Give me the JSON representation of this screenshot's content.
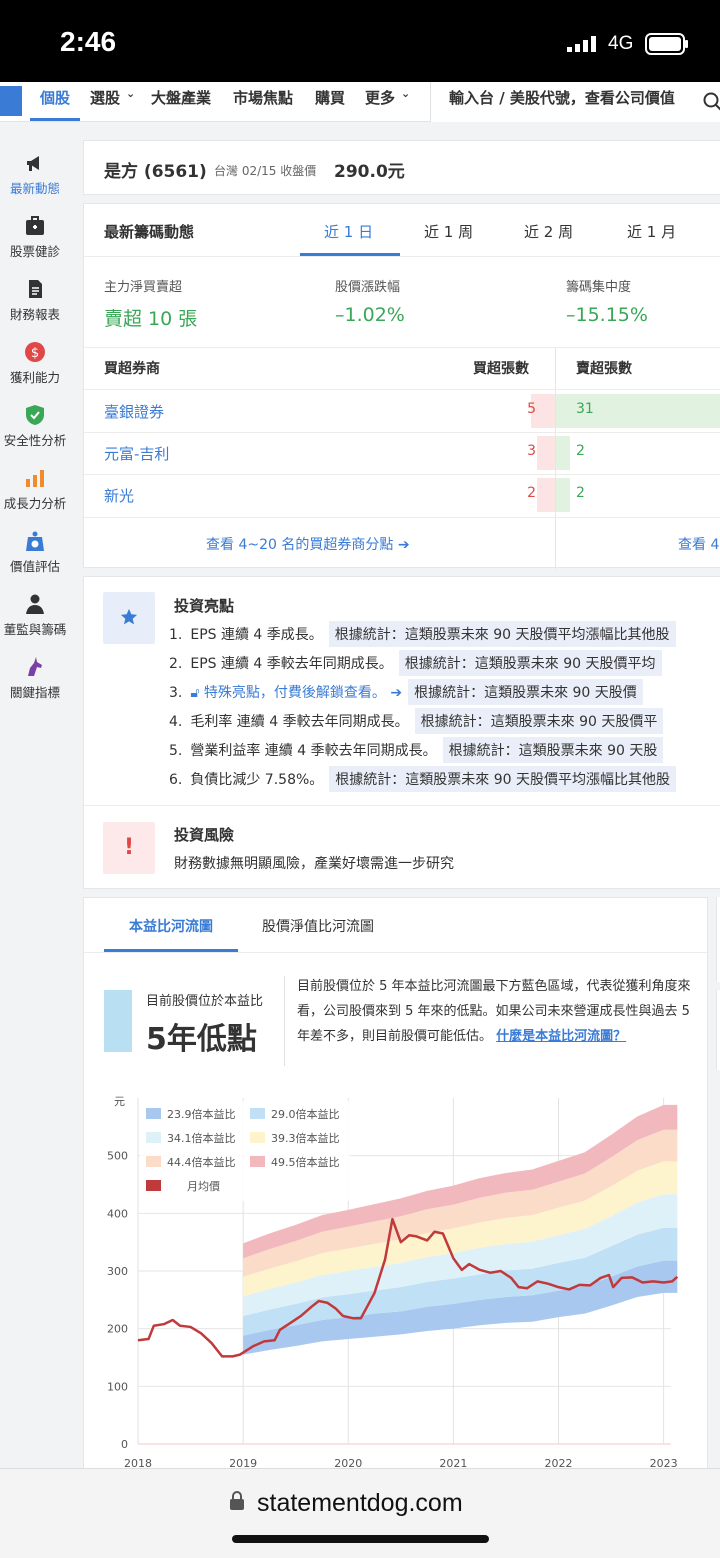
{
  "status": {
    "time": "2:46",
    "network": "4G"
  },
  "nav": {
    "items": [
      "個股",
      "選股",
      "大盤產業",
      "市場焦點",
      "購買",
      "更多"
    ],
    "search_placeholder": "輸入台 / 美股代號，查看公司價值"
  },
  "sidebar": {
    "items": [
      {
        "label": "最新動態",
        "icon": "megaphone-icon",
        "color": "#333333"
      },
      {
        "label": "股票健診",
        "icon": "medkit-icon",
        "color": "#333333"
      },
      {
        "label": "財務報表",
        "icon": "document-icon",
        "color": "#333333"
      },
      {
        "label": "獲利能力",
        "icon": "dollar-icon",
        "color": "#e04848"
      },
      {
        "label": "安全性分析",
        "icon": "shield-icon",
        "color": "#3aa757"
      },
      {
        "label": "成長力分析",
        "icon": "bars-icon",
        "color": "#f08c2e"
      },
      {
        "label": "價值評估",
        "icon": "scale-icon",
        "color": "#3a7bd5"
      },
      {
        "label": "董監與籌碼",
        "icon": "person-icon",
        "color": "#333333"
      },
      {
        "label": "關鍵指標",
        "icon": "unicorn-icon",
        "color": "#7b3fa5"
      }
    ]
  },
  "stock": {
    "name": "是方 (6561)",
    "meta": "台灣 02/15 收盤價",
    "price": "290.0元"
  },
  "chip": {
    "title": "最新籌碼動態",
    "tabs": [
      "近 1 日",
      "近 1 周",
      "近 2 周",
      "近 1 月"
    ],
    "metrics": [
      {
        "label": "主力淨買賣超",
        "value": "賣超 10 張"
      },
      {
        "label": "股價漲跌幅",
        "value": "–1.02%"
      },
      {
        "label": "籌碼集中度",
        "value": "–15.15%"
      }
    ],
    "col_broker": "買超券商",
    "col_buy": "買超張數",
    "col_sell": "賣超張數",
    "rows": [
      {
        "broker": "臺銀證券",
        "buy": "5",
        "sell": "31",
        "buy_val": 5,
        "sell_val": 31
      },
      {
        "broker": "元富-吉利",
        "buy": "3",
        "sell": "2",
        "buy_val": 3,
        "sell_val": 2
      },
      {
        "broker": "新光",
        "buy": "2",
        "sell": "2",
        "buy_val": 2,
        "sell_val": 2
      }
    ],
    "more_buy": "查看 4~20 名的買超券商分點",
    "more_sell": "查看 4"
  },
  "highlights": {
    "title": "投資亮點",
    "items": [
      {
        "no": "1.",
        "text": "EPS 連續 4 季成長。",
        "tag": "根據統計：這類股票未來 90 天股價平均漲幅比其他股"
      },
      {
        "no": "2.",
        "text": "EPS 連續 4 季較去年同期成長。",
        "tag": "根據統計：這類股票未來 90 天股價平均"
      },
      {
        "no": "3.",
        "text": "特殊亮點，付費後解鎖查看。",
        "tag": "根據統計：這類股票未來 90 天股價"
      },
      {
        "no": "4.",
        "text": "毛利率 連續 4 季較去年同期成長。",
        "tag": "根據統計：這類股票未來 90 天股價平"
      },
      {
        "no": "5.",
        "text": "營業利益率 連續 4 季較去年同期成長。",
        "tag": "根據統計：這類股票未來 90 天股"
      },
      {
        "no": "6.",
        "text": "負債比減少 7.58%。",
        "tag": "根據統計：這類股票未來 90 天股價平均漲幅比其他股"
      }
    ],
    "risk_title": "投資風險",
    "risk_text": "財務數據無明顯風險，產業好壞需進一步研究"
  },
  "pe": {
    "tabs": [
      "本益比河流圖",
      "股價淨值比河流圖"
    ],
    "position_label": "目前股價位於本益比",
    "position_value": "5年低點",
    "desc": "目前股價位於 5 年本益比河流圖最下方藍色區域，代表從獲利角度來看，公司股價來到 5 年來的低點。如果公司未來營運成長性與過去 5 年差不多，則目前股價可能低估。",
    "link": "什麼是本益比河流圖？"
  },
  "chart_data": {
    "type": "area",
    "ylabel": "元",
    "ylim": [
      0,
      600
    ],
    "yticks": [
      0,
      100,
      200,
      300,
      400,
      500
    ],
    "xticks": [
      "2018",
      "2019",
      "2020",
      "2021",
      "2022",
      "2023"
    ],
    "legend_position": "top-left",
    "bands": [
      {
        "name": "23.9倍本益比",
        "color": "#a9c8f0"
      },
      {
        "name": "29.0倍本益比",
        "color": "#bfe0f5"
      },
      {
        "name": "34.1倍本益比",
        "color": "#dff1f8"
      },
      {
        "name": "39.3倍本益比",
        "color": "#fdf3cc"
      },
      {
        "name": "44.4倍本益比",
        "color": "#fbdcc8"
      },
      {
        "name": "49.5倍本益比",
        "color": "#f1b8bd"
      }
    ],
    "price_series_name": "月均價",
    "price_color": "#c0393b",
    "price": [
      [
        2018.0,
        180
      ],
      [
        2018.1,
        182
      ],
      [
        2018.15,
        205
      ],
      [
        2018.25,
        208
      ],
      [
        2018.33,
        215
      ],
      [
        2018.4,
        205
      ],
      [
        2018.5,
        203
      ],
      [
        2018.6,
        192
      ],
      [
        2018.7,
        175
      ],
      [
        2018.8,
        152
      ],
      [
        2018.9,
        152
      ],
      [
        2018.97,
        155
      ],
      [
        2019.1,
        170
      ],
      [
        2019.2,
        178
      ],
      [
        2019.3,
        180
      ],
      [
        2019.35,
        198
      ],
      [
        2019.45,
        210
      ],
      [
        2019.55,
        222
      ],
      [
        2019.65,
        238
      ],
      [
        2019.72,
        248
      ],
      [
        2019.8,
        245
      ],
      [
        2019.88,
        235
      ],
      [
        2019.95,
        222
      ],
      [
        2020.05,
        218
      ],
      [
        2020.12,
        218
      ],
      [
        2020.25,
        262
      ],
      [
        2020.35,
        320
      ],
      [
        2020.42,
        390
      ],
      [
        2020.5,
        350
      ],
      [
        2020.58,
        362
      ],
      [
        2020.65,
        360
      ],
      [
        2020.75,
        353
      ],
      [
        2020.82,
        368
      ],
      [
        2020.9,
        365
      ],
      [
        2021.0,
        322
      ],
      [
        2021.08,
        302
      ],
      [
        2021.15,
        312
      ],
      [
        2021.25,
        302
      ],
      [
        2021.35,
        297
      ],
      [
        2021.45,
        300
      ],
      [
        2021.55,
        288
      ],
      [
        2021.62,
        272
      ],
      [
        2021.7,
        270
      ],
      [
        2021.8,
        282
      ],
      [
        2021.9,
        278
      ],
      [
        2022.0,
        272
      ],
      [
        2022.1,
        268
      ],
      [
        2022.2,
        276
      ],
      [
        2022.3,
        275
      ],
      [
        2022.4,
        288
      ],
      [
        2022.48,
        293
      ],
      [
        2022.52,
        272
      ],
      [
        2022.6,
        288
      ],
      [
        2022.7,
        289
      ],
      [
        2022.8,
        280
      ],
      [
        2022.9,
        282
      ],
      [
        2023.0,
        280
      ],
      [
        2023.08,
        282
      ],
      [
        2023.13,
        290
      ]
    ],
    "band_x": [
      2019.0,
      2019.25,
      2019.5,
      2019.75,
      2020.0,
      2020.25,
      2020.5,
      2020.75,
      2021.0,
      2021.25,
      2021.5,
      2021.75,
      2022.0,
      2022.25,
      2022.5,
      2022.75,
      2023.0,
      2023.13
    ],
    "band_bounds": [
      [
        155,
        163,
        170,
        178,
        182,
        186,
        190,
        196,
        200,
        206,
        210,
        212,
        220,
        226,
        240,
        255,
        262,
        262
      ],
      [
        188,
        198,
        206,
        215,
        220,
        226,
        230,
        238,
        243,
        250,
        255,
        258,
        266,
        274,
        290,
        308,
        318,
        318
      ],
      [
        222,
        233,
        243,
        254,
        260,
        266,
        272,
        281,
        287,
        294,
        301,
        304,
        314,
        323,
        343,
        363,
        375,
        375
      ],
      [
        256,
        269,
        280,
        293,
        300,
        307,
        314,
        324,
        331,
        340,
        347,
        351,
        362,
        373,
        395,
        419,
        433,
        433
      ],
      [
        290,
        304,
        317,
        331,
        339,
        347,
        355,
        366,
        374,
        384,
        392,
        397,
        410,
        422,
        447,
        474,
        490,
        490
      ],
      [
        322,
        338,
        352,
        368,
        377,
        386,
        395,
        407,
        415,
        427,
        436,
        441,
        455,
        469,
        497,
        527,
        545,
        545
      ],
      [
        348,
        365,
        380,
        397,
        406,
        416,
        426,
        439,
        448,
        461,
        470,
        476,
        491,
        506,
        536,
        568,
        588,
        588
      ]
    ]
  }
}
